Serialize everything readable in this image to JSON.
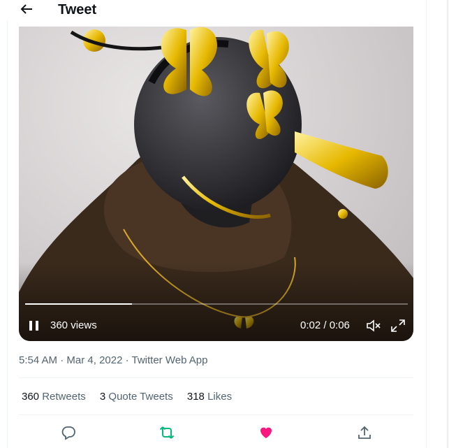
{
  "header": {
    "title": "Tweet",
    "back_icon": "arrow-left-icon"
  },
  "video": {
    "views": "360 views",
    "time": "0:02 / 0:06",
    "progress": 0.28,
    "pause_icon": "pause-icon",
    "mute_icon": "speaker-muted-icon",
    "fullscreen_icon": "expand-icon"
  },
  "meta": {
    "time": "5:54 AM",
    "sep1": " · ",
    "date": "Mar 4, 2022",
    "sep2": " · ",
    "app": "Twitter Web App"
  },
  "stats": [
    {
      "count": "360",
      "label": "Retweets"
    },
    {
      "count": "3",
      "label": "Quote Tweets"
    },
    {
      "count": "318",
      "label": "Likes"
    }
  ],
  "actions": [
    {
      "icon": "reply-icon",
      "color": "#536471"
    },
    {
      "icon": "retweet-icon",
      "color": "#00ba7c"
    },
    {
      "icon": "heart-icon",
      "color": "#f91880"
    },
    {
      "icon": "share-icon",
      "color": "#536471"
    }
  ]
}
